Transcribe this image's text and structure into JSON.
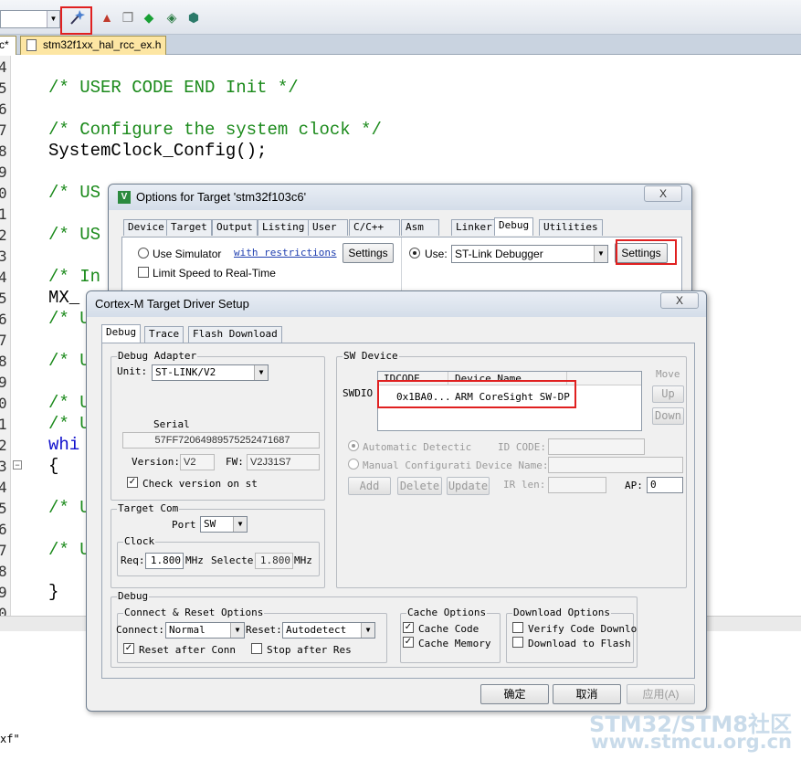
{
  "editor": {
    "tab_label": "stm32f1xx_hal_rcc_ex.h",
    "tab_prefix": "c*",
    "line_numbers": [
      "4",
      "5",
      "6",
      "7",
      "8",
      "9",
      "0",
      "1",
      "2",
      "3",
      "4",
      "5",
      "6",
      "7",
      "8",
      "9",
      "0",
      "1",
      "2",
      "3",
      "4",
      "5",
      "6",
      "7",
      "8",
      "9",
      "0"
    ],
    "lines": {
      "l1": "/* USER CODE END Init */",
      "l2": "/* Configure the system clock */",
      "l3": "SystemClock_Config();",
      "l4": "/* US",
      "l5": "/* US",
      "l6": "/* In",
      "l7": "MX_",
      "l8": "/* U",
      "l9": "/* U",
      "l10": "/* U",
      "l11": "/* U",
      "l12": "whi",
      "l13": "{",
      "l14": "/* U",
      "l15": "/* U",
      "l16": "}"
    },
    "bottom_text": "xf\""
  },
  "options_dialog": {
    "title": "Options for Target 'stm32f103c6'",
    "close": "X",
    "tabs": [
      "Device",
      "Target",
      "Output",
      "Listing",
      "User",
      "C/C++",
      "Asm",
      "Linker",
      "Debug",
      "Utilities"
    ],
    "use_simulator": "Use Simulator",
    "with_restrictions": "with restrictions",
    "settings_left": "Settings",
    "limit_speed": "Limit Speed to Real-Time",
    "use_label": "Use:",
    "debugger": "ST-Link Debugger",
    "settings_right": "Settings"
  },
  "driver_dialog": {
    "title": "Cortex-M Target Driver Setup",
    "close": "X",
    "tabs": [
      "Debug",
      "Trace",
      "Flash Download"
    ],
    "debug_adapter": {
      "group": "Debug Adapter",
      "unit_label": "Unit:",
      "unit_value": "ST-LINK/V2",
      "serial_label": "Serial",
      "serial_value": "57FF72064989575252471687",
      "version_label": "Version:",
      "version_value": "V2",
      "fw_label": "FW:",
      "fw_value": "V2J31S7",
      "check_version": "Check version on st"
    },
    "target_com": {
      "group": "Target Com",
      "port_label": "Port",
      "port_value": "SW",
      "clock_group": "Clock",
      "req_label": "Req:",
      "req_value": "1.800",
      "mhz1": "MHz",
      "selected_label": "Selecte",
      "selected_value": "1.800",
      "mhz2": "MHz"
    },
    "sw_device": {
      "group": "SW Device",
      "col_idcode": "IDCODE",
      "col_device": "Device Name",
      "row_label": "SWDIO",
      "row_idcode": "0x1BA0...",
      "row_device": "ARM CoreSight SW-DP",
      "move_label": "Move",
      "up": "Up",
      "down": "Down",
      "auto_detect": "Automatic Detectic",
      "manual_config": "Manual Configurati",
      "id_code_label": "ID CODE:",
      "device_name_label": "Device Name:",
      "add": "Add",
      "delete": "Delete",
      "update": "Update",
      "ir_len_label": "IR len:",
      "ap_label": "AP:",
      "ap_value": "0"
    },
    "debug_group": {
      "group": "Debug",
      "connect_reset": "Connect & Reset Options",
      "connect_label": "Connect:",
      "connect_value": "Normal",
      "reset_label": "Reset:",
      "reset_value": "Autodetect",
      "reset_after_conn": "Reset after Conn",
      "stop_after_res": "Stop after Res",
      "cache_options": "Cache Options",
      "cache_code": "Cache Code",
      "cache_memory": "Cache Memory",
      "download_options": "Download Options",
      "verify_code": "Verify Code Downlo",
      "download_flash": "Download to Flash"
    },
    "ok": "确定",
    "cancel": "取消",
    "apply": "应用(A)"
  },
  "watermark": {
    "line1": "STM32/STM8社区",
    "line2": "www.stmcu.org.cn"
  },
  "colors": {
    "highlight_box": "#e02020",
    "comment": "#1b8a1b",
    "keyword": "#1111cc"
  }
}
